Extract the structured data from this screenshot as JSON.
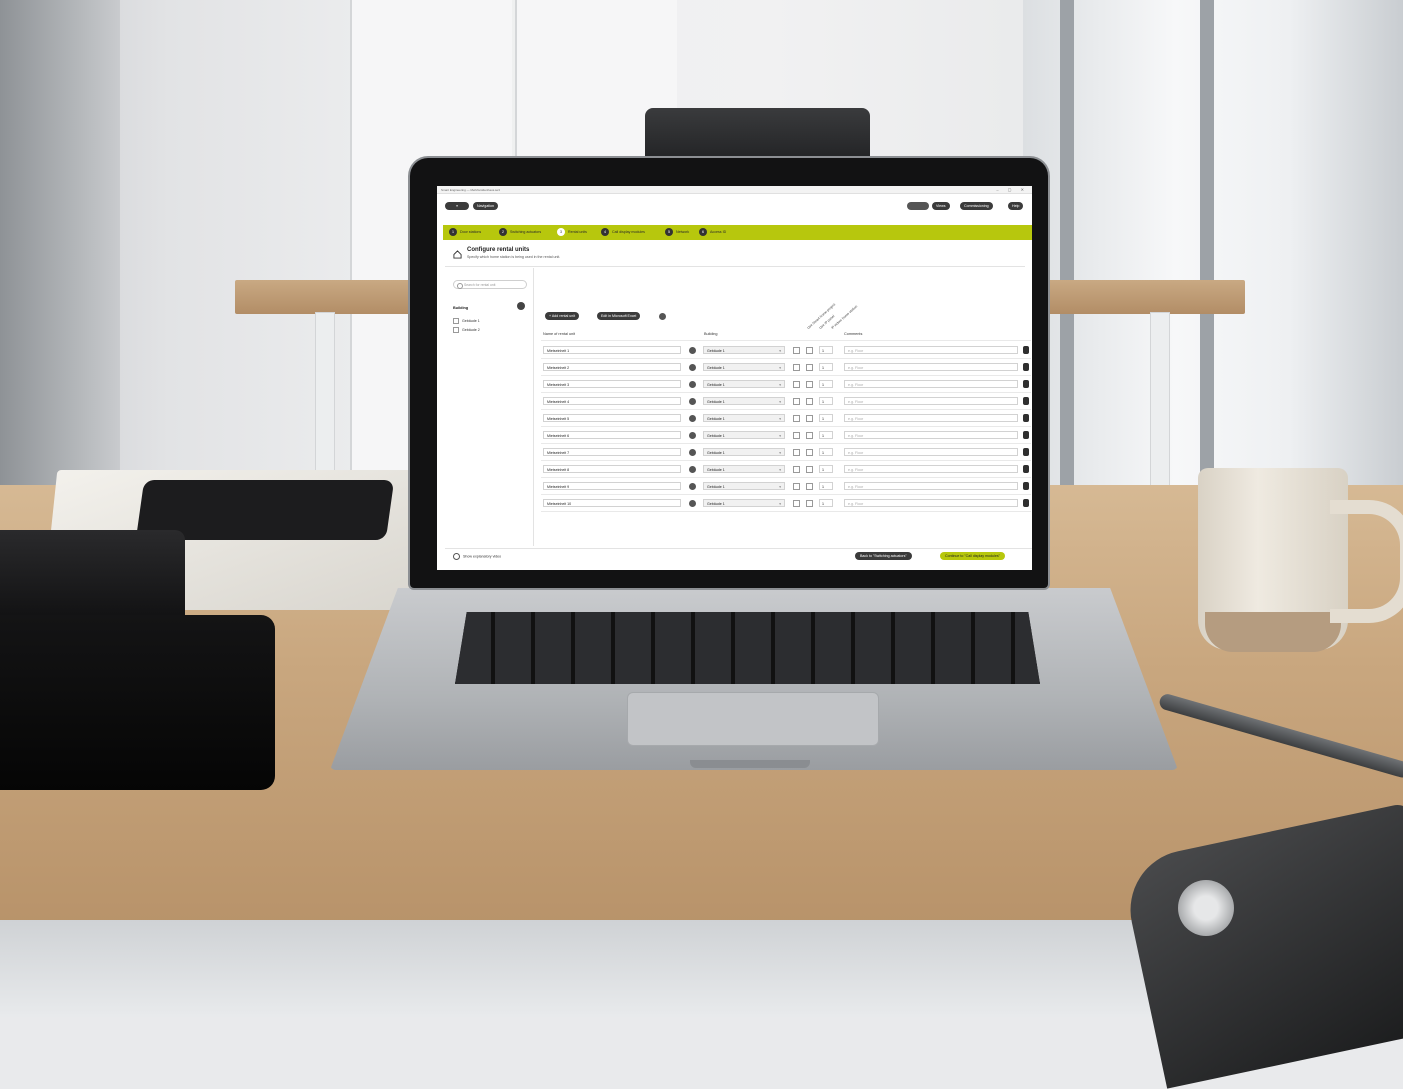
{
  "app": {
    "window_title": "Smart Engineering — Mehrfamilienhaus.se3",
    "window_controls": "– ▢ ✕"
  },
  "toolbar": {
    "menu_label": "≡",
    "navigation_label": "Navigation",
    "right_buttons": [
      "Views",
      "Commissioning",
      "Help"
    ]
  },
  "steps": [
    {
      "num": "1",
      "label": "Door stations",
      "active": false
    },
    {
      "num": "2",
      "label": "Switching actuators",
      "active": false
    },
    {
      "num": "3",
      "label": "Rental units",
      "active": true
    },
    {
      "num": "4",
      "label": "Call display modules",
      "active": false
    },
    {
      "num": "5",
      "label": "Network",
      "active": false
    },
    {
      "num": "6",
      "label": "Access ID",
      "active": false
    }
  ],
  "page": {
    "title": "Configure rental units",
    "subtitle": "Specify which home station is being used in the rental unit."
  },
  "sidebar": {
    "search_placeholder": "Search for rental unit",
    "group_title": "Building",
    "items": [
      "Gebäude 1",
      "Gebäude 2"
    ]
  },
  "actions": {
    "add_label": "+ Add rental unit",
    "excel_label": "Edit in Microsoft Excel"
  },
  "columns": {
    "name": "Name of rental unit",
    "building": "Building",
    "comments": "Comments",
    "rotated": [
      "Use Smart home project",
      "Use IP panel",
      "IP indoor home station"
    ]
  },
  "rows": [
    {
      "name": "Mietseinheit 1",
      "building": "Gebäude 1",
      "count": "1",
      "comment": "e.g. Floor"
    },
    {
      "name": "Mietseinheit 2",
      "building": "Gebäude 1",
      "count": "1",
      "comment": "e.g. Floor"
    },
    {
      "name": "Mietseinheit 3",
      "building": "Gebäude 1",
      "count": "1",
      "comment": "e.g. Floor"
    },
    {
      "name": "Mietseinheit 4",
      "building": "Gebäude 1",
      "count": "1",
      "comment": "e.g. Floor"
    },
    {
      "name": "Mietseinheit 5",
      "building": "Gebäude 1",
      "count": "1",
      "comment": "e.g. Floor"
    },
    {
      "name": "Mietseinheit 6",
      "building": "Gebäude 1",
      "count": "1",
      "comment": "e.g. Floor"
    },
    {
      "name": "Mietseinheit 7",
      "building": "Gebäude 1",
      "count": "1",
      "comment": "e.g. Floor"
    },
    {
      "name": "Mietseinheit 8",
      "building": "Gebäude 1",
      "count": "1",
      "comment": "e.g. Floor"
    },
    {
      "name": "Mietseinheit 9",
      "building": "Gebäude 1",
      "count": "1",
      "comment": "e.g. Floor"
    },
    {
      "name": "Mietseinheit 10",
      "building": "Gebäude 1",
      "count": "1",
      "comment": "e.g. Floor"
    }
  ],
  "footer": {
    "video_label": "Show explanatory video",
    "back_label": "Back to \"Switching actuators\"",
    "next_label": "Continue to \"Call display modules\""
  },
  "colors": {
    "accent": "#b7c70d",
    "dark_button": "#3b3b3b"
  }
}
